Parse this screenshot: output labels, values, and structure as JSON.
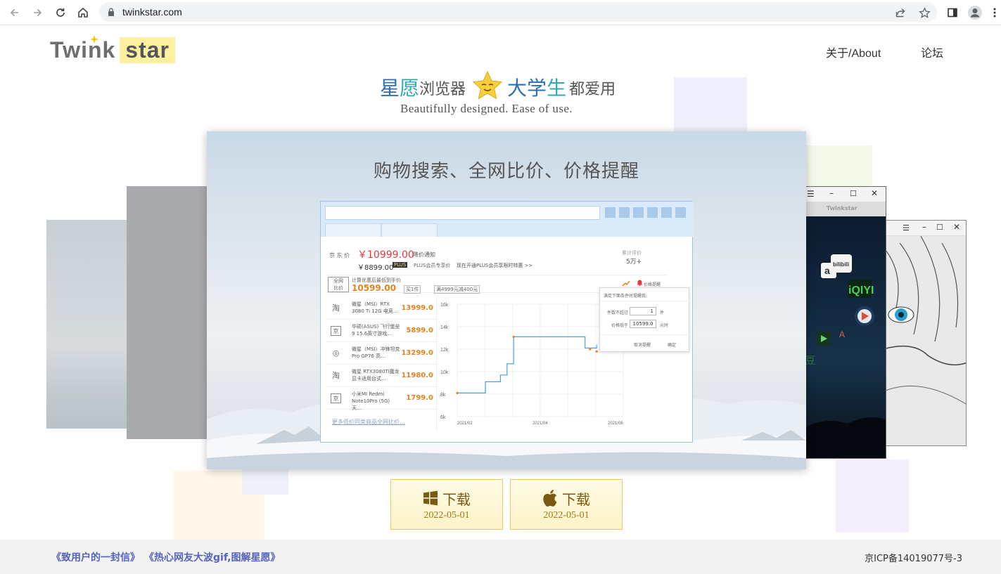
{
  "browser": {
    "url": "twinkstar.com"
  },
  "header": {
    "logo": {
      "part1": "Twink",
      "part2": "star"
    },
    "nav": [
      {
        "label": "关于/About"
      },
      {
        "label": "论坛"
      }
    ],
    "headline": {
      "a": "星",
      "b": "愿",
      "c": "浏览器",
      "d": "大学",
      "e": "生",
      "f": "都爱用"
    },
    "subtitle": "Beautifully designed. Ease of use."
  },
  "carousel": {
    "title": "购物搜索、全网比价、价格提醒",
    "screenshot": {
      "jd_label": "京 东 价",
      "price_main": "￥10999.00",
      "price_notice": "降价通知",
      "price_plus": "￥8899.00",
      "plus_badge": "PLUS",
      "plus_text": "PLUS会员专享价",
      "plus_promo": "现在开通PLUS会员享限时特惠 >>",
      "review_label": "累计评价",
      "review_count": "5万+",
      "calc_label": "计算优惠后最低到手价",
      "calc_price": "10599.00",
      "calc_buy": "买1件",
      "calc_coupon": "满4999元减400元",
      "alert_label": "价格提醒",
      "popup": {
        "title": "满足下面条件时提醒我:",
        "qty_label": "件数不超过",
        "qty_value": "1",
        "qty_unit": "件",
        "price_label": "价格低于",
        "price_value": "10599.0",
        "price_unit": "元时",
        "cancel": "取消提醒",
        "confirm": "确定"
      },
      "list": [
        {
          "icon": "淘",
          "name": "微星（MSI）RTX 3080 Ti 12G 电竞…",
          "price": "13999.0"
        },
        {
          "icon": "京",
          "name": "华硕(ASUS) 飞行堡垒9 15.6英寸游戏…",
          "price": "5899.0"
        },
        {
          "icon": "◎",
          "name": "微星（MSI）冲锋坦克Pro GP76 高…",
          "price": "13299.0"
        },
        {
          "icon": "淘",
          "name": "微星 RTX3080Ti魔龙显卡适用台式…",
          "price": "11980.0"
        },
        {
          "icon": "京",
          "name": "小米MI Redmi Note10Pro (5G) 天…",
          "price": "1799.0"
        }
      ],
      "more_link": "更多低价同类商品全网比价…",
      "chart_data": {
        "type": "line",
        "x": [
          "2021/02",
          "2021/04",
          "2021/06"
        ],
        "y_ticks": [
          "16k",
          "14k",
          "12k",
          "10k",
          "8k",
          "6k"
        ],
        "ylim": [
          6000,
          16000
        ]
      }
    },
    "right_card": {
      "title": "Twinkstar",
      "logos": [
        "bilibili",
        "iQIYI"
      ]
    }
  },
  "downloads": [
    {
      "label": "下载",
      "date": "2022-05-01",
      "platform_icon": "windows-icon"
    },
    {
      "label": "下载",
      "date": "2022-05-01",
      "platform_icon": "apple-icon"
    }
  ],
  "footer": {
    "links": [
      {
        "label": "《致用户的一封信》"
      },
      {
        "label": "《热心网友大波gif,图解星愿》"
      }
    ],
    "icp": "京ICP备14019077号-3"
  },
  "colors": {
    "accent_blue": "#2c6fb7",
    "accent_teal": "#2fa7b5",
    "price_red": "#e4393c",
    "download_border": "#e8c766",
    "footer_link": "#5563c1"
  }
}
